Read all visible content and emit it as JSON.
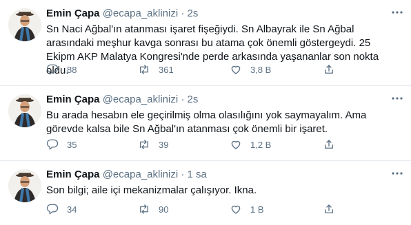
{
  "tweets": [
    {
      "name": "Emin Çapa",
      "handle": "@ecapa_aklinizi",
      "separator": "·",
      "time": "2s",
      "text": "Sn Naci Ağbal'ın atanması işaret fişeğiydi. Sn Albayrak ile Sn Ağbal arasındaki meşhur kavga sonrası bu atama çok önemli göstergeydi. 25 Ekipm AKP Malatya Kongresi'nde perde arkasında yaşananlar son nokta oldu.",
      "replies": "88",
      "retweets": "361",
      "likes": "3,8 B"
    },
    {
      "name": "Emin Çapa",
      "handle": "@ecapa_aklinizi",
      "separator": "·",
      "time": "2s",
      "text": "Bu arada hesabın ele geçirilmiş olma olasılığını yok saymayalım. Ama görevde kalsa bile Sn Ağbal'ın atanması çok önemli bir işaret.",
      "replies": "35",
      "retweets": "39",
      "likes": "1,2 B"
    },
    {
      "name": "Emin Çapa",
      "handle": "@ecapa_aklinizi",
      "separator": "·",
      "time": "1 sa",
      "text": "Son bilgi; aile içi mekanizmalar çalışıyor. Ikna.",
      "replies": "34",
      "retweets": "90",
      "likes": "1 B"
    }
  ],
  "icons": {
    "more": "more-horizontal-icon",
    "reply": "reply-icon",
    "retweet": "retweet-icon",
    "like": "heart-icon",
    "share": "share-icon"
  },
  "colors": {
    "text": "#0f1419",
    "secondary": "#5b7083",
    "divider": "#e6ecf0"
  }
}
